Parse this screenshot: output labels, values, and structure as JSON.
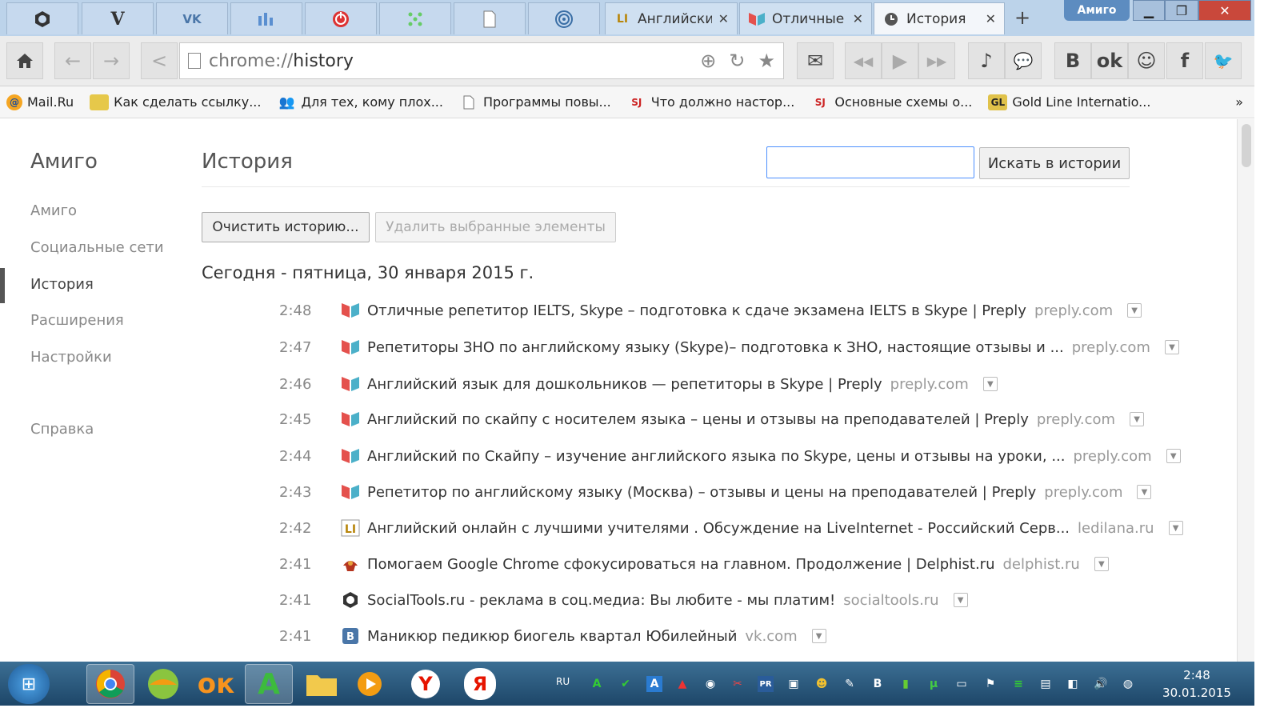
{
  "tabs_pinned": [
    {
      "icon": "socialtools-icon"
    },
    {
      "icon": "v-icon",
      "glyph": "V"
    },
    {
      "icon": "vk-icon",
      "glyph": "VK"
    },
    {
      "icon": "chart-icon"
    },
    {
      "icon": "power-icon"
    },
    {
      "icon": "dots-icon"
    },
    {
      "icon": "page-icon"
    },
    {
      "icon": "target-icon"
    }
  ],
  "tabs": [
    {
      "title": "Английски",
      "favicon": "LI"
    },
    {
      "title": "Отличные р",
      "favicon": "preply"
    },
    {
      "title": "История",
      "favicon": "clock"
    }
  ],
  "window": {
    "profile": "Амиго"
  },
  "omnibox": {
    "scheme": "chrome://",
    "host": "history"
  },
  "bookmarks": [
    {
      "label": "Mail.Ru",
      "icon": "mailru-icon"
    },
    {
      "label": "Как сделать ссылку...",
      "icon": "folder-icon"
    },
    {
      "label": "Для тех, кому плох...",
      "icon": "people-icon"
    },
    {
      "label": "Программы повы...",
      "icon": "page-icon"
    },
    {
      "label": "Что должно настор...",
      "icon": "sj-icon"
    },
    {
      "label": "Основные схемы о...",
      "icon": "sj-icon"
    },
    {
      "label": "Gold Line Internatio...",
      "icon": "gl-icon"
    }
  ],
  "bookmarks_more": "»",
  "sidebar": {
    "title": "Амиго",
    "items": [
      "Амиго",
      "Социальные сети",
      "История",
      "Расширения",
      "Настройки"
    ],
    "help": "Справка"
  },
  "history": {
    "title": "История",
    "search_button": "Искать в истории",
    "clear_button": "Очистить историю...",
    "remove_button": "Удалить выбранные элементы",
    "day_header": "Сегодня - пятница, 30 января 2015 г.",
    "entries": [
      {
        "time": "2:48",
        "title": "Отличные репетитор IELTS, Skype – подготовка к сдаче экзамена IELTS в Skype | Preply",
        "domain": "preply.com",
        "favicon": "preply"
      },
      {
        "time": "2:47",
        "title": "Репетиторы ЗНО по английскому языку (Skype)– подготовка к ЗНО, настоящие отзывы и ...",
        "domain": "preply.com",
        "favicon": "preply"
      },
      {
        "time": "2:46",
        "title": "Английский язык для дошкольников — репетиторы в Skype | Preply",
        "domain": "preply.com",
        "favicon": "preply"
      },
      {
        "time": "2:45",
        "title": "Английский по скайпу с носителем языка – цены и отзывы на преподавателей | Preply",
        "domain": "preply.com",
        "favicon": "preply"
      },
      {
        "time": "2:44",
        "title": "Английский по Скайпу – изучение английского языка по Skype, цены и отзывы на уроки, ...",
        "domain": "preply.com",
        "favicon": "preply"
      },
      {
        "time": "2:43",
        "title": "Репетитор по английскому языку (Москва) – отзывы и цены на преподавателей | Preply",
        "domain": "preply.com",
        "favicon": "preply"
      },
      {
        "time": "2:42",
        "title": "Английский онлайн с лучшими учителями . Обсуждение на LiveInternet - Российский Серв...",
        "domain": "ledilana.ru",
        "favicon": "li"
      },
      {
        "time": "2:41",
        "title": "Помогаем Google Chrome сфокусироваться на главном. Продолжение | Delphist.ru",
        "domain": "delphist.ru",
        "favicon": "delphist"
      },
      {
        "time": "2:41",
        "title": "SocialTools.ru - реклама в соц.медиа: Вы любите - мы платим!",
        "domain": "socialtools.ru",
        "favicon": "socialtools"
      },
      {
        "time": "2:41",
        "title": "Маникюр педикюр биогель квартал Юбилейный",
        "domain": "vk.com",
        "favicon": "vk"
      }
    ]
  },
  "taskbar": {
    "lang": "RU",
    "time": "2:48",
    "date": "30.01.2015",
    "apps": [
      "chrome-icon",
      "amigo-icon",
      "odnoklassniki-icon",
      "amigo-a-icon",
      "explorer-icon",
      "media-player-icon",
      "yandex-y-icon",
      "yandex-browser-icon"
    ]
  },
  "colors": {
    "accent": "#4d90fe",
    "tabstrip": "#bcd3ea",
    "taskbar": "#1d4668"
  }
}
